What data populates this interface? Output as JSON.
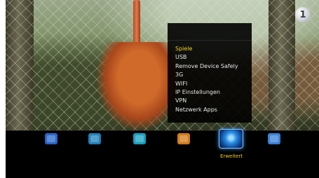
{
  "menu": {
    "items": [
      {
        "label": "Spiele",
        "selected": true
      },
      {
        "label": "USB",
        "selected": false
      },
      {
        "label": "Remove Device Safely",
        "selected": false
      },
      {
        "label": "3G",
        "selected": false
      },
      {
        "label": "WIFI",
        "selected": false
      },
      {
        "label": "IP Einstellungen",
        "selected": false
      },
      {
        "label": "VPN",
        "selected": false
      },
      {
        "label": "Netzwerk Apps",
        "selected": false
      }
    ]
  },
  "toolbar": {
    "selected_label": "Erweitert",
    "items": [
      {
        "icon": "globe-icon",
        "color": "#2a66c9"
      },
      {
        "icon": "media-icon",
        "color": "#1f7fb8"
      },
      {
        "icon": "picture-icon",
        "color": "#19a0c0"
      },
      {
        "icon": "box-icon",
        "color": "#d07a1a"
      },
      {
        "icon": "advanced-globe-icon",
        "color": "#2a8fe6"
      },
      {
        "icon": "tv-icon",
        "color": "#3a7fd6"
      }
    ]
  },
  "colors": {
    "highlight": "#f0d020",
    "menu_text": "#e8e8e8",
    "menu_background": "#000000"
  },
  "channel_logo": {
    "icon": "channel-logo-icon",
    "glyph": "1"
  }
}
